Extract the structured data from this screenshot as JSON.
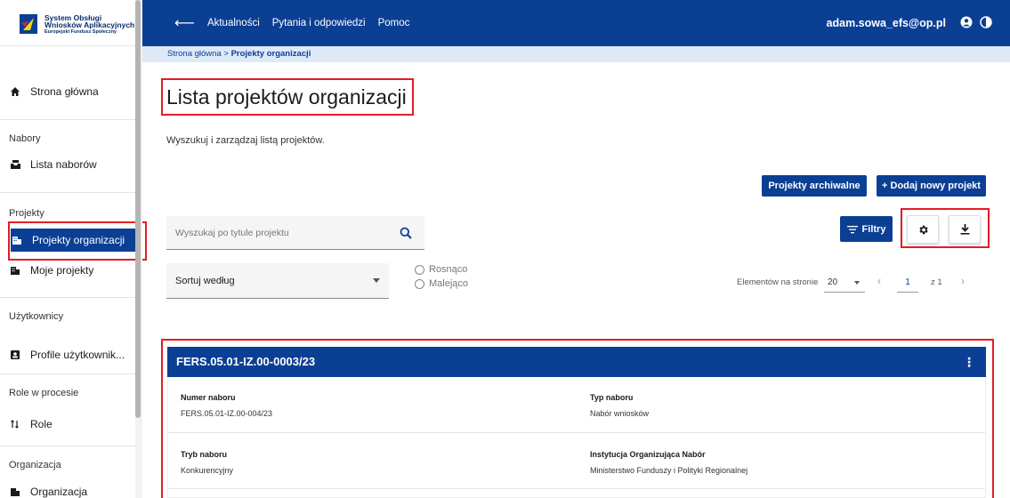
{
  "logo": {
    "line1": "System Obsługi",
    "line2": "Wniosków Aplikacyjnych",
    "line3": "Europejski Fundusz Społeczny"
  },
  "sidebar": {
    "items": [
      {
        "label": "Strona główna",
        "icon": "home-icon"
      },
      {
        "section": "Nabory"
      },
      {
        "label": "Lista naborów",
        "icon": "inbox-icon"
      },
      {
        "section": "Projekty"
      },
      {
        "label": "Projekty organizacji",
        "icon": "building-icon",
        "active": true
      },
      {
        "label": "Moje projekty",
        "icon": "building-icon"
      },
      {
        "section": "Użytkownicy"
      },
      {
        "label": "Profile użytkownik...",
        "icon": "id-card-icon"
      },
      {
        "section": "Role w procesie"
      },
      {
        "label": "Role",
        "icon": "sort-icon"
      },
      {
        "section": "Organizacja"
      },
      {
        "label": "Organizacja",
        "icon": "building-icon"
      }
    ]
  },
  "topbar": {
    "nav": [
      "Aktualności",
      "Pytania i odpowiedzi",
      "Pomoc"
    ],
    "user": "adam.sowa_efs@op.pl"
  },
  "breadcrumb": {
    "home": "Strona główna",
    "separator": ">",
    "current": "Projekty organizacji"
  },
  "page": {
    "title": "Lista projektów organizacji",
    "subtitle": "Wyszukuj i zarządzaj listą projektów."
  },
  "actions": {
    "archived": "Projekty archiwalne",
    "add_new": "+ Dodaj nowy projekt",
    "filters": "Filtry"
  },
  "search": {
    "placeholder": "Wyszukaj po tytule projektu"
  },
  "sort": {
    "label": "Sortuj według",
    "asc": "Rosnąco",
    "desc": "Malejąco"
  },
  "pagination": {
    "per_page_label": "Elementów na stronie",
    "per_page": "20",
    "page": "1",
    "of": "z 1"
  },
  "card": {
    "title": "FERS.05.01-IZ.00-0003/23",
    "fields": [
      {
        "label": "Numer naboru",
        "value": "FERS.05.01-IZ.00-004/23"
      },
      {
        "label": "Typ naboru",
        "value": "Nabór wniosków"
      },
      {
        "label": "Tryb naboru",
        "value": "Konkurencyjny"
      },
      {
        "label": "Instytucja Organizująca Nabór",
        "value": "Ministerstwo Funduszy i Polityki Regionalnej"
      }
    ]
  },
  "colors": {
    "primary": "#0b3f94",
    "highlight": "#e11d28",
    "breadcrumb_bg": "#dde9f7"
  }
}
